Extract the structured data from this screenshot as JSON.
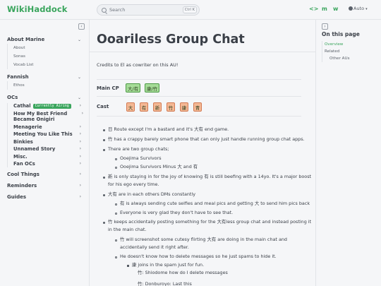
{
  "app": {
    "title": "WikiHaddock",
    "theme_label": "Auto"
  },
  "search": {
    "placeholder": "Search",
    "shortcut": "Ctrl K"
  },
  "sidebar": {
    "groups": [
      {
        "label": "About Marine",
        "items": [
          "About",
          "Sonas",
          "Vocab List"
        ]
      },
      {
        "label": "Fannish",
        "items": [
          "Ethos"
        ]
      },
      {
        "label": "OCs"
      },
      {
        "label": "Cool Things"
      },
      {
        "label": "Reminders"
      },
      {
        "label": "Guides"
      }
    ],
    "ocs": [
      {
        "label": "Cathal",
        "badge": "Currently Airing"
      },
      {
        "label": "How My Best Friend Became Onigiri"
      },
      {
        "label": "Menagerie"
      },
      {
        "label": "Meeting You Like This"
      },
      {
        "label": "Binkies"
      },
      {
        "label": "Unnamed Story"
      },
      {
        "label": "Misc."
      },
      {
        "label": "Fan OCs"
      }
    ]
  },
  "main": {
    "title": "Ooariless Group Chat",
    "credits": "Credits to El as cowriter on this AU!",
    "main_cp_label": "Main CP",
    "main_cp": [
      "大/有",
      "康/竹"
    ],
    "cast_label": "Cast",
    "cast": [
      "大",
      "有",
      "新",
      "竹",
      "康",
      "青"
    ],
    "bullets": [
      "日 Route except I'm a bastard and it's 大有 end game.",
      "竹 has a crappy barely smart phone that can only just handle running group chat apps.",
      "There are two group chats;",
      "Ooejima Survivors",
      "Ooejima Survivors Minus 大 and 有",
      "新 is only staying in for the joy of knowing 有 is still beefing with a 14yo. It's a major boost",
      "for his ego every time.",
      "大有 are in each others DMs constantly",
      "有 is always sending cute selfies and meal pics and getting 大 to send him pics back",
      "Everyone is very glad they don't have to see that.",
      "竹 keeps accidentally posting something for the 大有less group chat and instead posting it",
      "in the main chat.",
      "竹 will screenshot some cutesy flirting 大有 are doing in the main chat and",
      "accidentally send it right after.",
      "He doesn't know how to delete messages so he just spams to hide it.",
      "康 joins in the spam just for fun.",
      "竹: Shiodome how do I delete messages",
      "竹: Donburoyo: Last this"
    ]
  },
  "toc": {
    "title": "On this page",
    "items": [
      "Overview",
      "Related",
      "Other AUs"
    ]
  }
}
